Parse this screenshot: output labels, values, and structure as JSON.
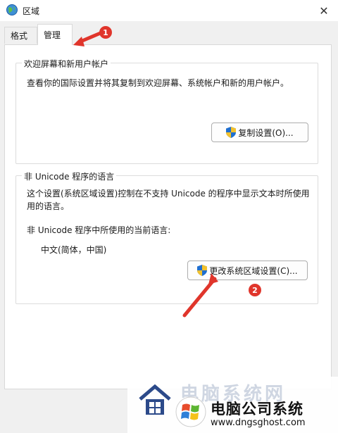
{
  "window": {
    "title": "区域"
  },
  "tabs": [
    {
      "label": "格式",
      "active": false
    },
    {
      "label": "管理",
      "active": true
    }
  ],
  "welcome_group": {
    "legend": "欢迎屏幕和新用户帐户",
    "description": "查看你的国际设置并将其复制到欢迎屏幕、系统帐户和新的用户帐户。",
    "button_label": "复制设置(O)..."
  },
  "unicode_group": {
    "legend": "非 Unicode 程序的语言",
    "description_line1": "这个设置(系统区域设置)控制在不支持 Unicode 的程序中显示文本时所使用",
    "description_line2": "用的语言。",
    "current_label": "非 Unicode 程序中所使用的当前语言:",
    "current_value": "中文(简体，中国)",
    "button_label": "更改系统区域设置(C)..."
  },
  "annotations": {
    "badge1": "1",
    "badge2": "2"
  },
  "watermark": {
    "faded_text": "电脑系统网",
    "title": "电脑公司系统",
    "url": "www.dngsghost.com"
  },
  "colors": {
    "accent_red": "#e0352b",
    "uac_blue": "#1f6fd0",
    "uac_yellow": "#f2c12e"
  }
}
